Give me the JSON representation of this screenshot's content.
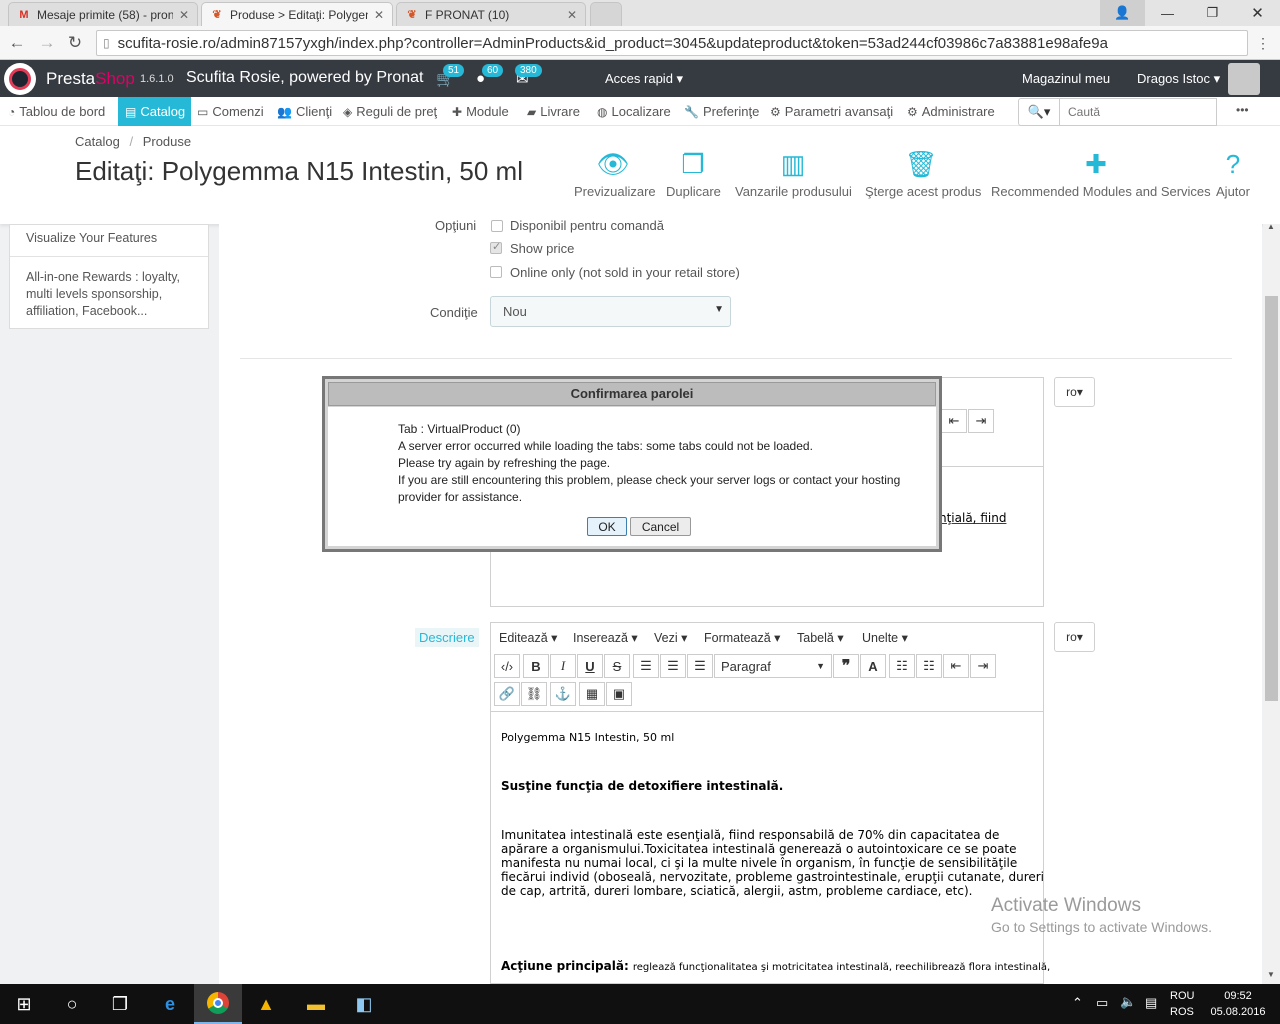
{
  "browser": {
    "tabs": [
      {
        "label": "Mesaje primite (58) - pron",
        "icon": "gmail-icon"
      },
      {
        "label": "Produse > Editaţi: Polygen",
        "icon": "prestashop-icon"
      },
      {
        "label": "F PRONAT (10)",
        "icon": "prestashop-icon"
      }
    ],
    "url": "scufita-rosie.ro/admin87157yxgh/index.php?controller=AdminProducts&id_product=3045&updateproduct&token=53ad244cf03986c7a83881e98afe9a"
  },
  "topbar": {
    "brand_presta": "Presta",
    "brand_shop": "Shop",
    "version": "1.6.1.0",
    "shop_name": "Scufita Rosie, powered by Pronat",
    "badge_orders": "51",
    "badge_customers": "60",
    "badge_messages": "380",
    "quick_access": "Acces rapid",
    "my_shop": "Magazinul meu",
    "user": "Dragos  Istoc"
  },
  "menu": {
    "items": [
      "Tablou de bord",
      "Catalog",
      "Comenzi",
      "Clienţi",
      "Reguli de preţ",
      "Module",
      "Livrare",
      "Localizare",
      "Preferinţe",
      "Parametri avansaţi",
      "Administrare"
    ],
    "search_placeholder": "Caută",
    "more": "•••"
  },
  "header": {
    "breadcrumb_1": "Catalog",
    "breadcrumb_sep": "/",
    "breadcrumb_2": "Produse",
    "title": "Editaţi: Polygemma N15 Intestin, 50 ml",
    "actions": [
      "Previzualizare",
      "Duplicare",
      "Vanzarile produsului",
      "Şterge acest produs",
      "Recommended Modules and Services",
      "Ajutor"
    ]
  },
  "sidebar": {
    "items": [
      "Visualize Your Features",
      "All-in-one Rewards : loyalty, multi levels sponsorship, affiliation, Facebook..."
    ]
  },
  "form": {
    "options_label": "Opţiuni",
    "opt_available": "Disponibil pentru comandă",
    "opt_show_price": "Show price",
    "opt_online_only": "Online only (not sold in your retail store)",
    "condition_label": "Condiţie",
    "condition_value": "Nou",
    "lang": "ro",
    "short_desc_partial": "nţială, fiind",
    "desc_label": "Descriere",
    "editor_menu": [
      "Editează",
      "Inserează",
      "Vezi",
      "Formatează",
      "Tabelă",
      "Unelte"
    ],
    "format_select": "Paragraf"
  },
  "description": {
    "line1": "Polygemma N15 Intestin, 50 ml",
    "heading": "Susţine funcţia de detoxifiere intestinală.",
    "para1_l1": "Imunitatea intestinală este esenţială, fiind responsabilă de 70% din capacitatea de",
    "para1_l2": "apărare a organismului.Toxicitatea intestinală generează o autointoxicare ce se poate",
    "para1_l3": "manifesta nu numai local, ci şi la multe nivele în organism, în funcţie de sensibilităţile",
    "para1_l4": "fiecărui individ (oboseală, nervozitate, probleme gastrointestinale, erupţii cutanate, dureri",
    "para1_l5": "de cap, artrită, dureri lombare, sciatică, alergii, astm, probleme cardiace, etc).",
    "action_label": "Acţiune principală:",
    "action_text": "reglează funcţionalitatea şi motricitatea intestinală, reechilibrează flora intestinală,"
  },
  "dialog": {
    "title": "Confirmarea parolei",
    "line1": "Tab : VirtualProduct (0)",
    "line2": "A server error occurred while loading the tabs: some tabs could not be loaded.",
    "line3": "Please try again by refreshing the page.",
    "line4": "If you are still encountering this problem, please check your server logs or contact your hosting",
    "line5": "provider for assistance.",
    "ok": "OK",
    "cancel": "Cancel"
  },
  "watermark": {
    "line1": "Activate Windows",
    "line2": "Go to Settings to activate Windows."
  },
  "taskbar": {
    "lang1": "ROU",
    "lang2": "ROS",
    "time": "09:52",
    "date": "05.08.2016"
  },
  "colors": {
    "accent": "#25b9d7",
    "topbar": "#363a41",
    "brand_red": "#df0067"
  }
}
